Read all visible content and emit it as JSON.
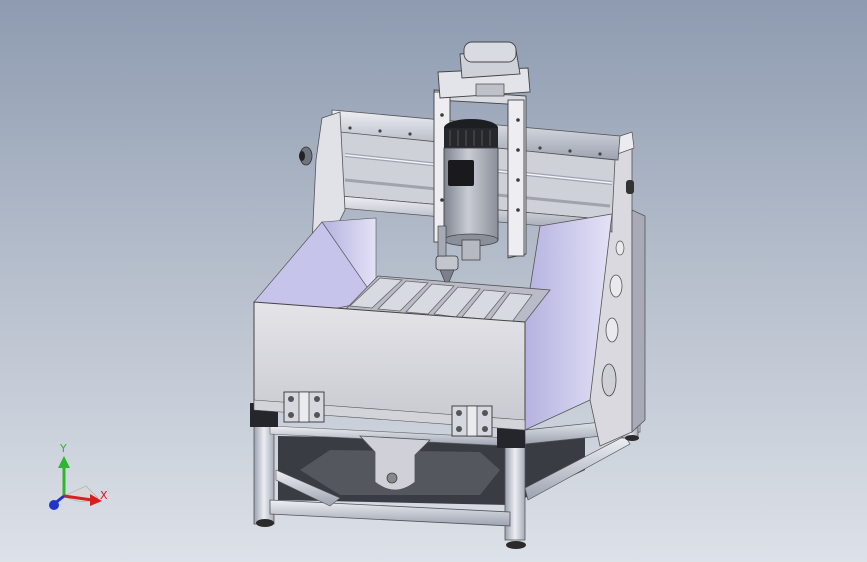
{
  "viewport": {
    "background_top": "#8e9bb0",
    "background_bottom": "#dde1e8"
  },
  "model": {
    "icons": [
      "spindle-motor-icon",
      "gantry-icon",
      "table-icon",
      "frame-icon",
      "hinge-icon"
    ]
  },
  "triad": {
    "y_label": "Y",
    "x_label": "X",
    "y_color": "#2fb52f",
    "x_color": "#d42020",
    "z_color": "#2233cc"
  }
}
